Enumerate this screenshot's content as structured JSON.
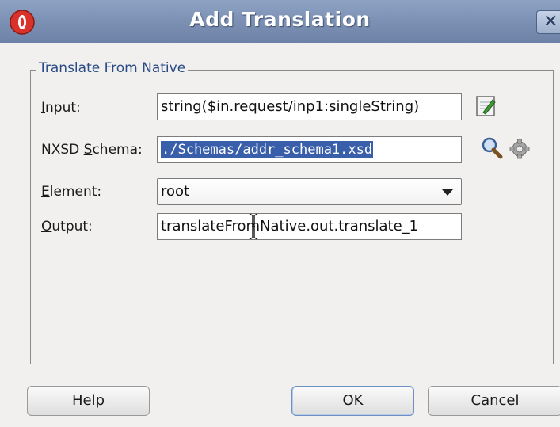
{
  "dialog": {
    "title": "Add Translation"
  },
  "group": {
    "legend": "Translate From Native"
  },
  "fields": {
    "input": {
      "label_mnemonic": "I",
      "label_rest": "nput:",
      "value": "string($in.request/inp1:singleString)"
    },
    "schema": {
      "label_pre": "NXSD ",
      "label_mnemonic": "S",
      "label_rest": "chema:",
      "value": "./Schemas/addr_schema1.xsd"
    },
    "element": {
      "label_mnemonic": "E",
      "label_rest": "lement:",
      "value": "root"
    },
    "output": {
      "label_mnemonic": "O",
      "label_rest": "utput:",
      "value": "translateFromNative.out.translate_1"
    }
  },
  "buttons": {
    "help_mnemonic": "H",
    "help_rest": "elp",
    "ok": "OK",
    "cancel": "Cancel"
  },
  "icons": {
    "app": "oracle-app-icon",
    "close": "close-icon",
    "edit": "edit-expression-icon",
    "search": "search-icon",
    "gear": "gear-icon"
  },
  "colors": {
    "titlebar": "#7d92b5",
    "legend_text": "#2a4b86",
    "selection": "#3a5faa",
    "app_icon": "#d8322a"
  }
}
